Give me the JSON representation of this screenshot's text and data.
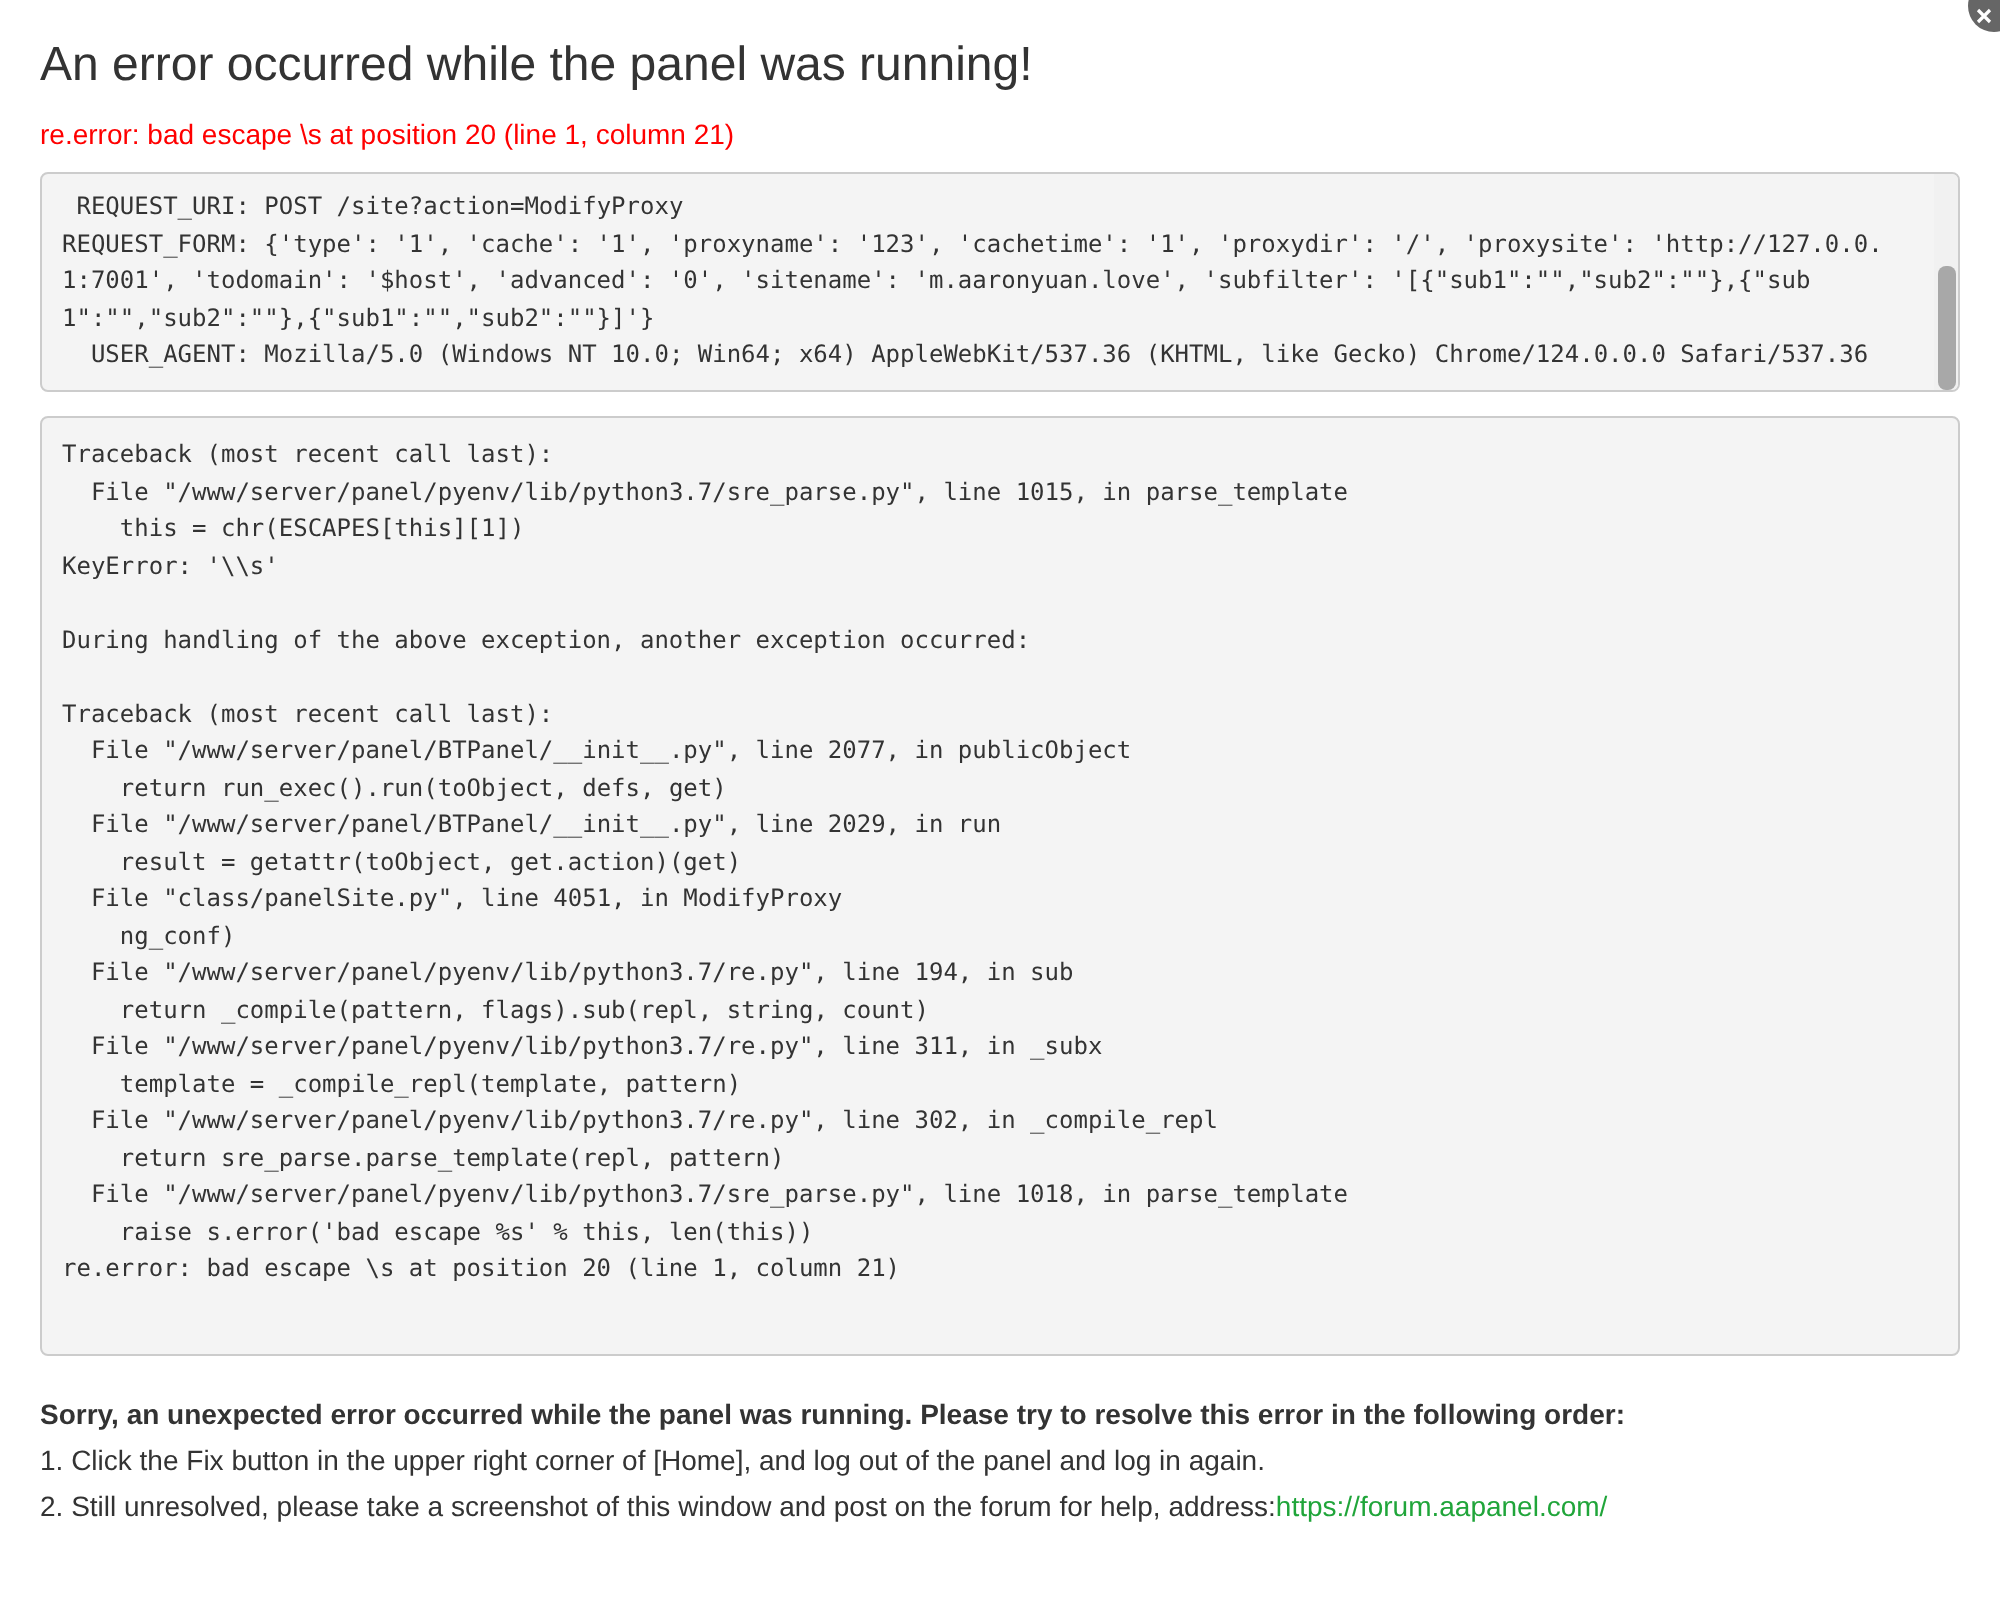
{
  "title": "An error occurred while the panel was running!",
  "error_message": "re.error: bad escape \\s at position 20 (line 1, column 21)",
  "request_lines": [
    " REQUEST_URI: POST /site?action=ModifyProxy",
    "REQUEST_FORM: {'type': '1', 'cache': '1', 'proxyname': '123', 'cachetime': '1', 'proxydir': '/', 'proxysite': 'http://127.0.0.1:7001', 'todomain': '$host', 'advanced': '0', 'sitename': 'm.aaronyuan.love', 'subfilter': '[{\"sub1\":\"\",\"sub2\":\"\"},{\"sub1\":\"\",\"sub2\":\"\"},{\"sub1\":\"\",\"sub2\":\"\"}]'}",
    "  USER_AGENT: Mozilla/5.0 (Windows NT 10.0; Win64; x64) AppleWebKit/537.36 (KHTML, like Gecko) Chrome/124.0.0.0 Safari/537.36"
  ],
  "traceback_blocks": [
    [
      "Traceback (most recent call last):",
      "  File \"/www/server/panel/pyenv/lib/python3.7/sre_parse.py\", line 1015, in parse_template",
      "    this = chr(ESCAPES[this][1])",
      "KeyError: '\\\\s'"
    ],
    [
      "During handling of the above exception, another exception occurred:"
    ],
    [
      "Traceback (most recent call last):",
      "  File \"/www/server/panel/BTPanel/__init__.py\", line 2077, in publicObject",
      "    return run_exec().run(toObject, defs, get)",
      "  File \"/www/server/panel/BTPanel/__init__.py\", line 2029, in run",
      "    result = getattr(toObject, get.action)(get)",
      "  File \"class/panelSite.py\", line 4051, in ModifyProxy",
      "    ng_conf)",
      "  File \"/www/server/panel/pyenv/lib/python3.7/re.py\", line 194, in sub",
      "    return _compile(pattern, flags).sub(repl, string, count)",
      "  File \"/www/server/panel/pyenv/lib/python3.7/re.py\", line 311, in _subx",
      "    template = _compile_repl(template, pattern)",
      "  File \"/www/server/panel/pyenv/lib/python3.7/re.py\", line 302, in _compile_repl",
      "    return sre_parse.parse_template(repl, pattern)",
      "  File \"/www/server/panel/pyenv/lib/python3.7/sre_parse.py\", line 1018, in parse_template",
      "    raise s.error('bad escape %s' % this, len(this))",
      "re.error: bad escape \\s at position 20 (line 1, column 21)"
    ]
  ],
  "help": {
    "heading": "Sorry, an unexpected error occurred while the panel was running. Please try to resolve this error in the following order:",
    "steps": [
      {
        "text": "1. Click the Fix button in the upper right corner of [Home], and log out of the panel and log in again."
      },
      {
        "text": "2. Still unresolved, please take a screenshot of this window and post on the forum for help, address:",
        "link": "https://forum.aapanel.com/"
      }
    ]
  }
}
